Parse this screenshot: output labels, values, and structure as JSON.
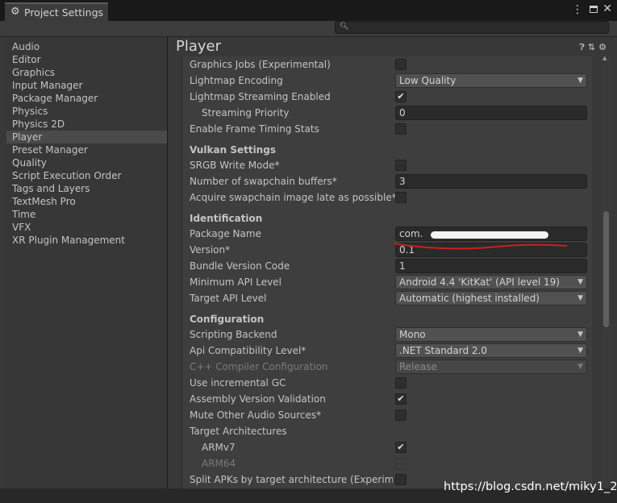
{
  "window": {
    "title": "Project Settings"
  },
  "search": {
    "placeholder": ""
  },
  "sidebar": {
    "items": [
      {
        "label": "Audio"
      },
      {
        "label": "Editor"
      },
      {
        "label": "Graphics"
      },
      {
        "label": "Input Manager"
      },
      {
        "label": "Package Manager"
      },
      {
        "label": "Physics"
      },
      {
        "label": "Physics 2D"
      },
      {
        "label": "Player"
      },
      {
        "label": "Preset Manager"
      },
      {
        "label": "Quality"
      },
      {
        "label": "Script Execution Order"
      },
      {
        "label": "Tags and Layers"
      },
      {
        "label": "TextMesh Pro"
      },
      {
        "label": "Time"
      },
      {
        "label": "VFX"
      },
      {
        "label": "XR Plugin Management"
      }
    ],
    "selected": "Player"
  },
  "page": {
    "title": "Player"
  },
  "settings": {
    "graphics_jobs": {
      "label": "Graphics Jobs (Experimental)",
      "checked": false
    },
    "lightmap_encoding": {
      "label": "Lightmap Encoding",
      "value": "Low Quality"
    },
    "lightmap_streaming": {
      "label": "Lightmap Streaming Enabled",
      "checked": true
    },
    "streaming_priority": {
      "label": "Streaming Priority",
      "value": "0"
    },
    "frame_timing": {
      "label": "Enable Frame Timing Stats",
      "checked": false
    },
    "vulkan_header": "Vulkan Settings",
    "srgb_write": {
      "label": "SRGB Write Mode*",
      "checked": false
    },
    "swapchain_buffers": {
      "label": "Number of swapchain buffers*",
      "value": "3"
    },
    "acquire_swapchain": {
      "label": "Acquire swapchain image late as possible*",
      "checked": false
    },
    "identification_header": "Identification",
    "package_name": {
      "label": "Package Name",
      "value": "com."
    },
    "version": {
      "label": "Version*",
      "value": "0.1"
    },
    "bundle_version_code": {
      "label": "Bundle Version Code",
      "value": "1"
    },
    "min_api": {
      "label": "Minimum API Level",
      "value": "Android 4.4 'KitKat' (API level 19)"
    },
    "target_api": {
      "label": "Target API Level",
      "value": "Automatic (highest installed)"
    },
    "configuration_header": "Configuration",
    "scripting_backend": {
      "label": "Scripting Backend",
      "value": "Mono"
    },
    "api_compat": {
      "label": "Api Compatibility Level*",
      "value": ".NET Standard 2.0"
    },
    "cpp_compiler": {
      "label": "C++ Compiler Configuration",
      "value": "Release",
      "disabled": true
    },
    "incremental_gc": {
      "label": "Use incremental GC",
      "checked": false
    },
    "assembly_validation": {
      "label": "Assembly Version Validation",
      "checked": true
    },
    "mute_audio": {
      "label": "Mute Other Audio Sources*",
      "checked": false
    },
    "target_arch": {
      "label": "Target Architectures"
    },
    "armv7": {
      "label": "ARMv7",
      "checked": true
    },
    "arm64": {
      "label": "ARM64",
      "checked": false,
      "disabled": true
    },
    "split_apks": {
      "label": "Split APKs by target architecture (Experimental)",
      "checked": false
    }
  },
  "watermark": "https://blog.csdn.net/miky1_2",
  "icons": {
    "tab": "gear-icon",
    "menu": "kebab-menu-icon",
    "maximize": "maximize-icon",
    "close": "close-icon",
    "search": "search-icon",
    "help": "help-icon",
    "presets": "sliders-icon",
    "settings": "gear-icon"
  },
  "colors": {
    "background": "#383838",
    "selection": "#4a4a4a",
    "annotation": "#cc1f1f"
  }
}
